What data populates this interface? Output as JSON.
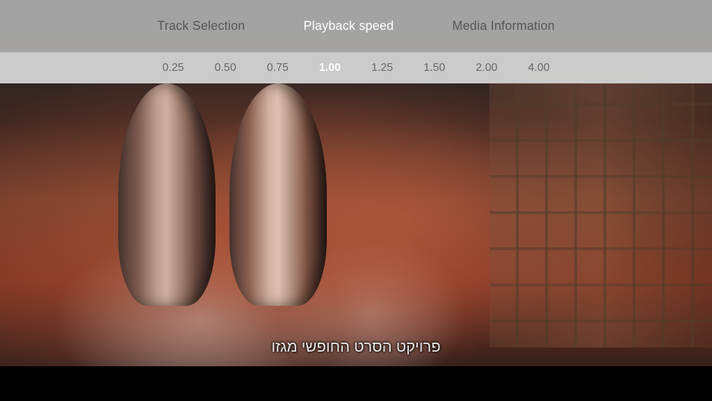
{
  "tabs": [
    {
      "id": "track-selection",
      "label": "Track Selection",
      "active": false
    },
    {
      "id": "playback-speed",
      "label": "Playback speed",
      "active": true
    },
    {
      "id": "media-information",
      "label": "Media Information",
      "active": false
    }
  ],
  "speeds": [
    {
      "value": "0.25",
      "selected": false
    },
    {
      "value": "0.50",
      "selected": false
    },
    {
      "value": "0.75",
      "selected": false
    },
    {
      "value": "1.00",
      "selected": true
    },
    {
      "value": "1.25",
      "selected": false
    },
    {
      "value": "1.50",
      "selected": false
    },
    {
      "value": "2.00",
      "selected": false
    },
    {
      "value": "4.00",
      "selected": false
    }
  ],
  "subtitle": {
    "text": "פרויקט הסרט החופשי מגזו"
  },
  "colors": {
    "tab_active": "#ffffff",
    "tab_inactive": "#555555",
    "speed_selected": "#ffffff",
    "speed_unselected": "#666666",
    "top_bar_bg": "rgba(180,180,180,0.88)",
    "speed_bar_bg": "rgba(210,210,210,0.85)"
  }
}
